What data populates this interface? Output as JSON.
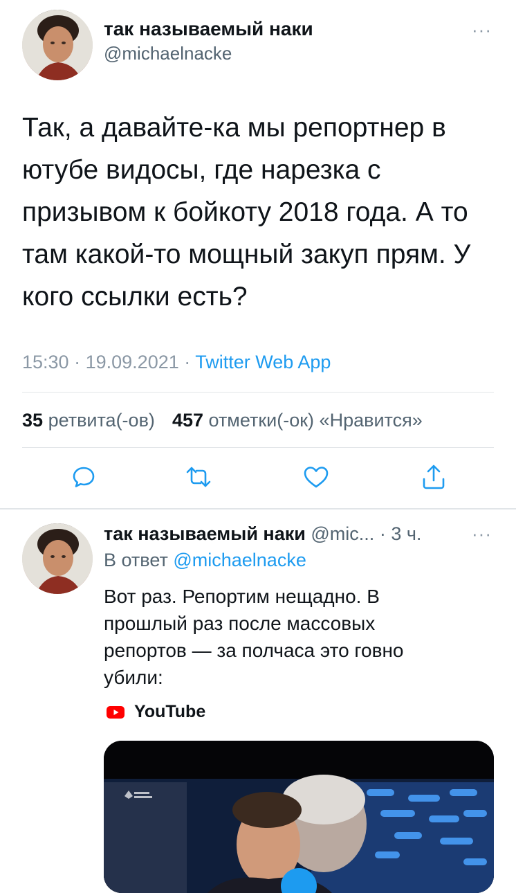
{
  "main_tweet": {
    "author_name": "так называемый наки",
    "author_handle": "@michaelnacke",
    "more_label": "···",
    "text": "Так, а давайте-ка мы репортнер в ютубе видосы, где нарезка с призывом к бойкоту 2018 года. А то там какой-то мощный закуп прям. У кого ссылки есть?",
    "time": "15:30",
    "sep1": "·",
    "date": "19.09.2021",
    "sep2": "·",
    "source": "Twitter Web App",
    "retweets_count": "35",
    "retweets_label": "ретвита(-ов)",
    "likes_count": "457",
    "likes_label": "отметки(-ок) «Нравится»"
  },
  "actions": {
    "icons": [
      "reply-icon",
      "retweet-icon",
      "like-icon",
      "share-icon"
    ]
  },
  "reply_tweet": {
    "author_name": "так называемый наки",
    "author_handle": "@mic...",
    "time_sep": "·",
    "time": "3 ч.",
    "more_label": "···",
    "reply_prefix": "В ответ",
    "reply_to": "@michaelnacke",
    "text": "Вот раз. Репортим нещадно. В прошлый раз после массовых репортов — за полчаса это говно убили:",
    "link_source": "YouTube"
  },
  "colors": {
    "accent": "#1d9bf0",
    "secondary_text": "#536471",
    "divider": "#e1e5e8",
    "youtube_red": "#ff0000"
  }
}
